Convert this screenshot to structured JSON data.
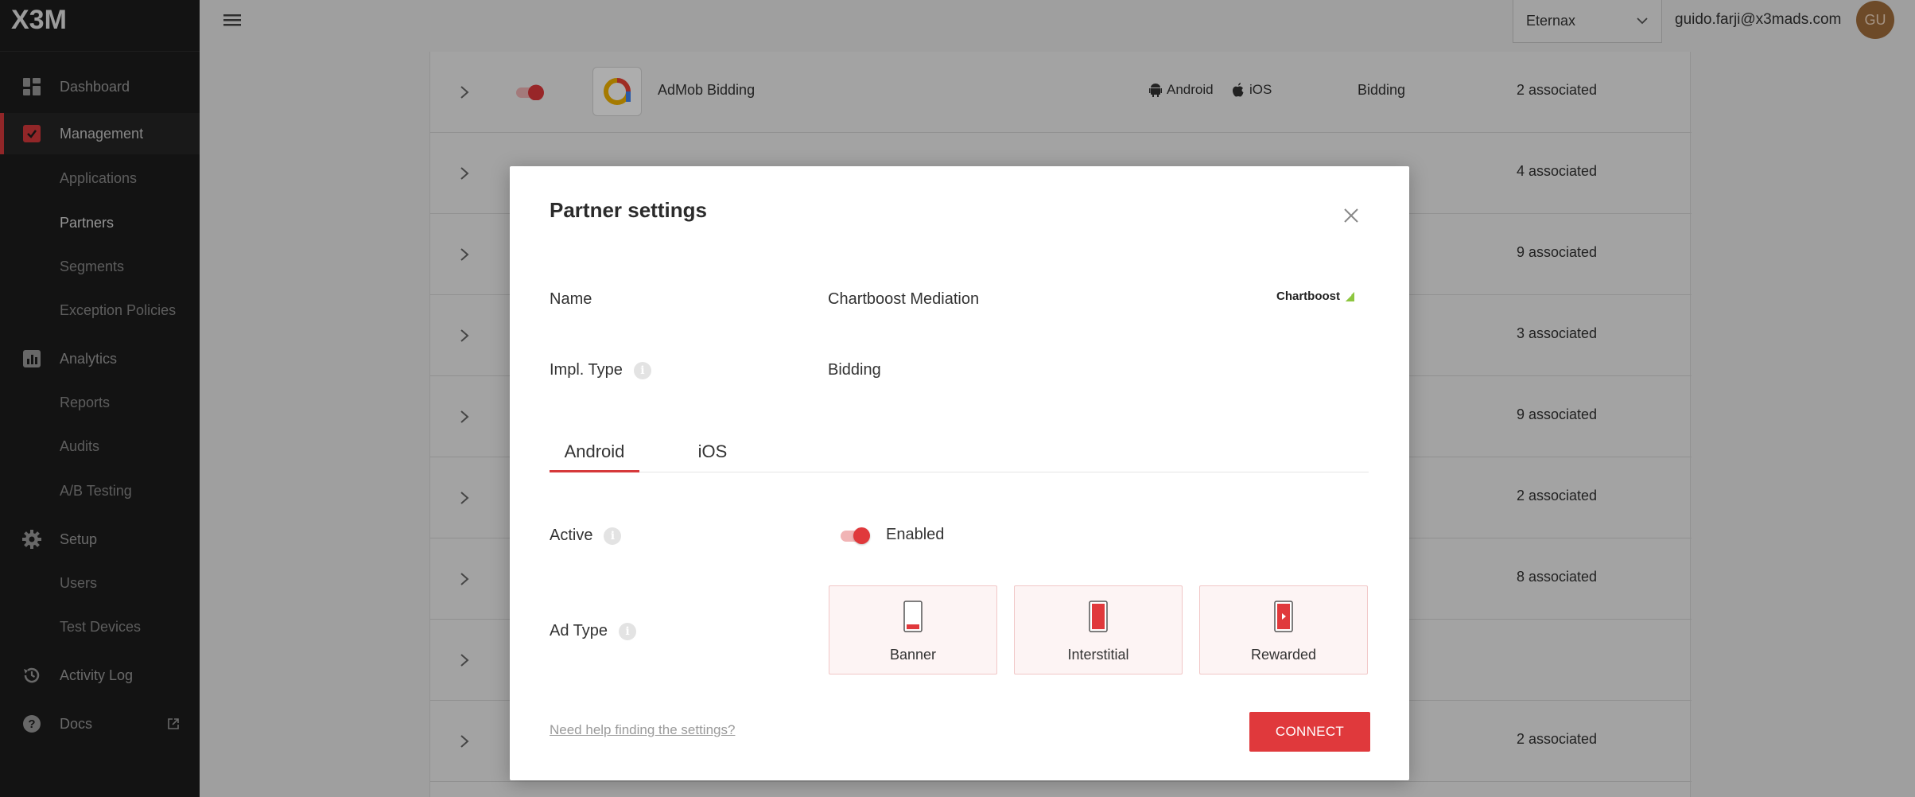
{
  "header": {
    "logo_text": "X3M",
    "organization": "Eternax",
    "user_email": "guido.farji@x3mads.com",
    "avatar_initials": "GU"
  },
  "sidebar": {
    "dashboard": "Dashboard",
    "management": "Management",
    "applications": "Applications",
    "partners": "Partners",
    "segments": "Segments",
    "exception_policies": "Exception Policies",
    "analytics": "Analytics",
    "reports": "Reports",
    "audits": "Audits",
    "ab_testing": "A/B Testing",
    "setup": "Setup",
    "users": "Users",
    "test_devices": "Test Devices",
    "activity_log": "Activity Log",
    "docs": "Docs"
  },
  "table": {
    "first_row": {
      "name": "AdMob Bidding",
      "android": "Android",
      "ios": "iOS",
      "type": "Bidding",
      "associated": "2 associated"
    },
    "associated": [
      "2 associated",
      "4 associated",
      "9 associated",
      "3 associated",
      "9 associated",
      "2 associated",
      "8 associated",
      "",
      "2 associated"
    ]
  },
  "modal": {
    "title": "Partner settings",
    "name_label": "Name",
    "name_value": "Chartboost Mediation",
    "partner_logo_text": "Chartboost",
    "impl_type_label": "Impl. Type",
    "impl_type_value": "Bidding",
    "tabs": [
      {
        "label": "Android",
        "active": true
      },
      {
        "label": "iOS",
        "active": false
      }
    ],
    "active_label": "Active",
    "active_value": "Enabled",
    "active_enabled": true,
    "ad_type_label": "Ad Type",
    "ad_types": [
      "Banner",
      "Interstitial",
      "Rewarded"
    ],
    "help_link": "Need help finding the settings?",
    "connect_button": "CONNECT"
  },
  "colors": {
    "accent": "#e0393c",
    "sidebar_bg": "#1c1c1c"
  }
}
